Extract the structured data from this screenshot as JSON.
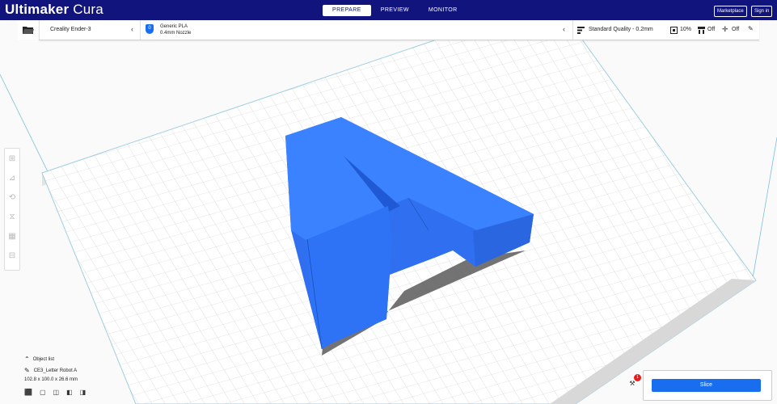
{
  "app": {
    "brand_bold": "Ultimaker",
    "brand_light": "Cura"
  },
  "stages": [
    {
      "label": "PREPARE",
      "active": true
    },
    {
      "label": "PREVIEW",
      "active": false
    },
    {
      "label": "MONITOR",
      "active": false
    }
  ],
  "top_buttons": {
    "marketplace": "Marketplace",
    "signin": "Sign in"
  },
  "printer": {
    "name": "Creality Ender-3"
  },
  "material": {
    "name": "Generic PLA",
    "nozzle": "0.4mm Nozzle",
    "extruder_number": "0"
  },
  "profile": {
    "label": "Standard Quality - 0.2mm",
    "infill": "10%",
    "support": "Off",
    "adhesion": "Off"
  },
  "object_list": {
    "title": "Object list",
    "object_name": "CE3_Letter Robot A",
    "dimensions": "102.8 x 100.0 x 26.6 mm"
  },
  "slice": {
    "label": "Slice",
    "badge_count": "1"
  },
  "colors": {
    "topbar": "#10147c",
    "accent": "#196ef0",
    "model": "#2d6fe8",
    "badge": "#e41e1e"
  }
}
